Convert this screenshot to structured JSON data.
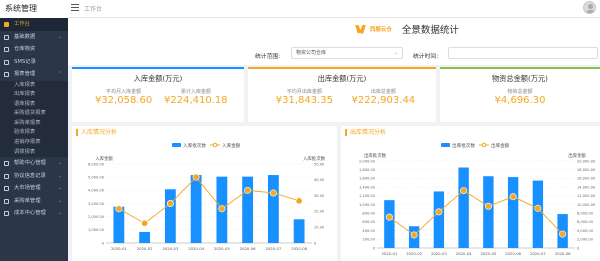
{
  "app": {
    "title": "系统管理",
    "breadcrumb": "工作台"
  },
  "sidebar": {
    "items": [
      {
        "label": "工作台",
        "active": true
      },
      {
        "label": "基础数据",
        "arrow": "⌄"
      },
      {
        "label": "仓库物资"
      },
      {
        "label": "SMS记录"
      },
      {
        "label": "报表管理",
        "arrow": "⌃"
      },
      {
        "label": "入库报表",
        "sub": true
      },
      {
        "label": "出库报表",
        "sub": true
      },
      {
        "label": "退库报表",
        "sub": true
      },
      {
        "label": "采购退货报表",
        "sub": true
      },
      {
        "label": "采购单报表",
        "sub": true
      },
      {
        "label": "验收报表",
        "sub": true
      },
      {
        "label": "进销存报表",
        "sub": true
      },
      {
        "label": "调拨报表",
        "sub": true
      },
      {
        "label": "帮助中心管理",
        "arrow": "⌄"
      },
      {
        "label": "协议信息记录",
        "arrow": "⌄"
      },
      {
        "label": "大市场管理",
        "arrow": "⌄"
      },
      {
        "label": "采购单管理",
        "arrow": "⌄"
      },
      {
        "label": "成本中心管理",
        "arrow": "⌄"
      }
    ]
  },
  "header": {
    "logo_text": "西厨云仓",
    "title": "全景数据统计",
    "range_label": "统计范围:",
    "range_value": "物资公司仓库",
    "time_label": "统计时间:"
  },
  "cards": [
    {
      "title": "入库金额(万元)",
      "bar_color": "#1890ff",
      "stats": [
        {
          "label": "平均月入库金额",
          "value": "¥32,058.60"
        },
        {
          "label": "累计入库金额",
          "value": "¥224,410.18"
        }
      ]
    },
    {
      "title": "出库金额(万元)",
      "bar_color": "#f5a623",
      "stats": [
        {
          "label": "平均月出库金额",
          "value": "¥31,843.35"
        },
        {
          "label": "出库总金额",
          "value": "¥222,903.44"
        }
      ]
    },
    {
      "title": "物资总金额(万元)",
      "bar_color": "#8bc34a",
      "stats": [
        {
          "label": "物资总金额",
          "value": "¥4,696.30"
        }
      ]
    }
  ],
  "colors": {
    "accent": "#f5a623",
    "bar": "#1890ff",
    "line": "#f5a623"
  },
  "chart_data": [
    {
      "panel_title": "入库情况分析",
      "type": "bar",
      "categories": [
        "2020-01",
        "2020-02",
        "2020-03",
        "2020-04",
        "2020-05",
        "2020-06",
        "2020-07",
        "2020-08"
      ],
      "series": [
        {
          "name": "入库批次数",
          "type": "bar",
          "axis": "right",
          "values": [
            23,
            7,
            34,
            43,
            42,
            42,
            43,
            15
          ]
        },
        {
          "name": "入库金额",
          "type": "line",
          "axis": "left",
          "values": [
            2600,
            1500,
            3000,
            5000,
            2600,
            4000,
            3800,
            3200
          ]
        }
      ],
      "left_axis": {
        "label": "入库金额",
        "ticks": [
          "0",
          "1,000.00",
          "2,000.00",
          "3,000.00",
          "4,000.00",
          "5,000.00",
          "6,000.00"
        ],
        "max": 6000
      },
      "right_axis": {
        "label": "入库批次数",
        "ticks": [
          "0",
          "10.00",
          "20.00",
          "30.00",
          "40.00",
          "50.00"
        ],
        "max": 50
      },
      "legend": "top-center",
      "grid": true
    },
    {
      "panel_title": "出库情况分析",
      "type": "bar",
      "categories": [
        "2020-01",
        "2020-02",
        "2020-03",
        "2020-04",
        "2020-05",
        "2020-06",
        "2020-07",
        "2020-08"
      ],
      "series": [
        {
          "name": "出库批次数",
          "type": "bar",
          "axis": "left",
          "values": [
            1100,
            500,
            1300,
            1850,
            1650,
            1630,
            1550,
            780
          ]
        },
        {
          "name": "出库金额",
          "type": "line",
          "axis": "right",
          "values": [
            7100,
            3000,
            8300,
            13200,
            9600,
            11800,
            9100,
            3200
          ]
        }
      ],
      "left_axis": {
        "label": "出库批次数",
        "ticks": [
          "0",
          "200.00",
          "400.00",
          "600.00",
          "800.00",
          "1,000.00",
          "1,200.00",
          "1,400.00",
          "1,600.00",
          "1,800.00",
          "2,000.00"
        ],
        "max": 2000
      },
      "right_axis": {
        "label": "出库金额",
        "ticks": [
          "0",
          "2,000.00",
          "4,000.00",
          "6,000.00",
          "8,000.00",
          "10,000.00",
          "12,000.00",
          "14,000.00",
          "16,000.00",
          "18,000.00",
          "20,000.00"
        ],
        "max": 20000
      },
      "legend": "top-center",
      "grid": true
    }
  ]
}
